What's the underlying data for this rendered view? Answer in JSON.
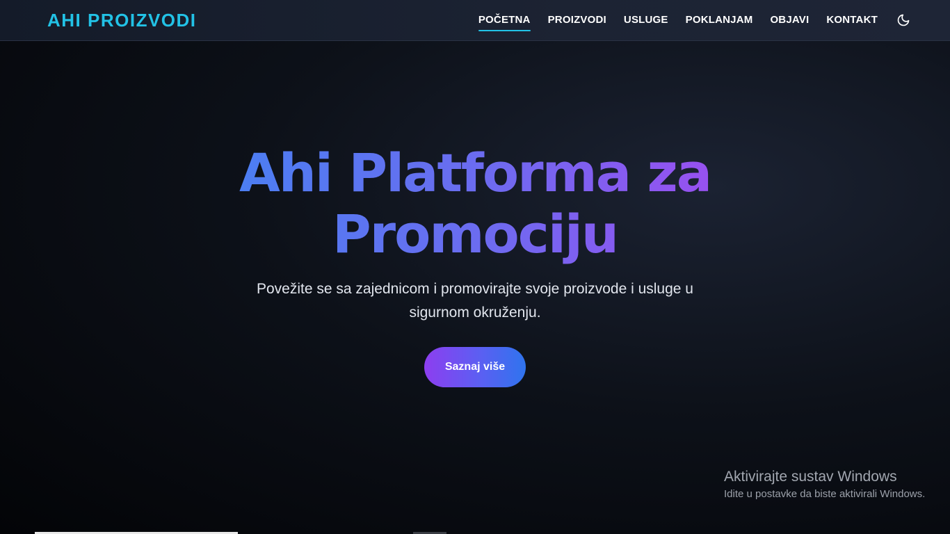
{
  "header": {
    "logo": "AHI PROIZVODI",
    "nav": [
      {
        "label": "POČETNA",
        "active": true
      },
      {
        "label": "PROIZVODI",
        "active": false
      },
      {
        "label": "USLUGE",
        "active": false
      },
      {
        "label": "POKLANJAM",
        "active": false
      },
      {
        "label": "OBJAVI",
        "active": false
      },
      {
        "label": "KONTAKT",
        "active": false
      }
    ],
    "theme_icon": "moon-icon"
  },
  "hero": {
    "title": "Ahi Platforma za Promociju",
    "subtitle": "Povežite se sa zajednicom i promovirajte svoje proizvode i usluge u sigurnom okruženju.",
    "cta_label": "Saznaj više"
  },
  "watermark": {
    "title": "Aktivirajte sustav Windows",
    "subtitle": "Idite u postavke da biste aktivirali Windows."
  },
  "colors": {
    "accent": "#22c2e6",
    "gradient_start": "#4a7ff2",
    "gradient_end": "#9a4ff0",
    "button_start": "#8d3ef0",
    "button_end": "#2f74ee"
  }
}
